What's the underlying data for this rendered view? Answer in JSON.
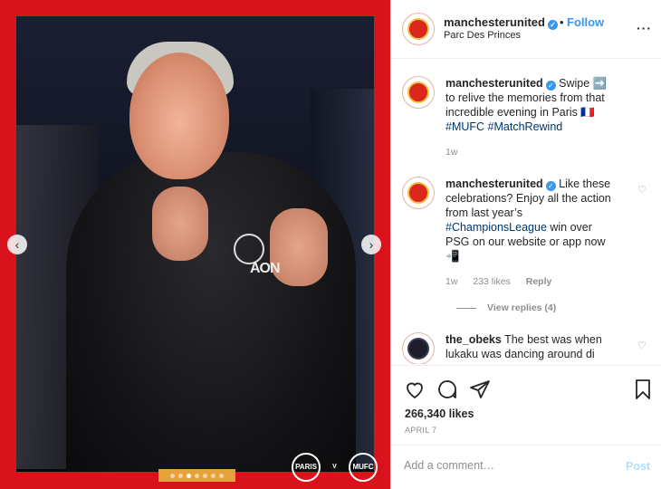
{
  "header": {
    "username": "manchesterunited",
    "separator": "•",
    "follow_label": "Follow",
    "location": "Parc Des Princes",
    "more_icon": "more-horizontal-icon"
  },
  "media": {
    "current_slide": 3,
    "total_slides": 7,
    "sponsor_text": "AON",
    "match_badge_left": "PARIS",
    "match_badge_right": "MUFC",
    "vs_label": "V"
  },
  "comments": [
    {
      "username": "manchesterunited",
      "text_parts": [
        "Swipe ➡️ to relive the memories from that incredible evening in Paris 🇫🇷 "
      ],
      "tags": [
        "#MUFC",
        "#MatchRewind"
      ],
      "time": "1w"
    },
    {
      "username": "manchesterunited",
      "text_before": "Like these celebrations? Enjoy all the action from last year’s ",
      "tag": "#ChampionsLeague",
      "text_after": " win over PSG on our website or app now 📲",
      "time": "1w",
      "likes": "233 likes",
      "reply_label": "Reply",
      "view_replies": "View replies (4)"
    },
    {
      "username": "the_obeks",
      "text": "The best was when lukaku was dancing around di"
    }
  ],
  "actions": {
    "likes": "266,340 likes",
    "date": "APRIL 7"
  },
  "comment_box": {
    "placeholder": "Add a comment…",
    "post_label": "Post"
  },
  "colors": {
    "brand_red": "#d8131b",
    "link_blue": "#3897f0"
  }
}
